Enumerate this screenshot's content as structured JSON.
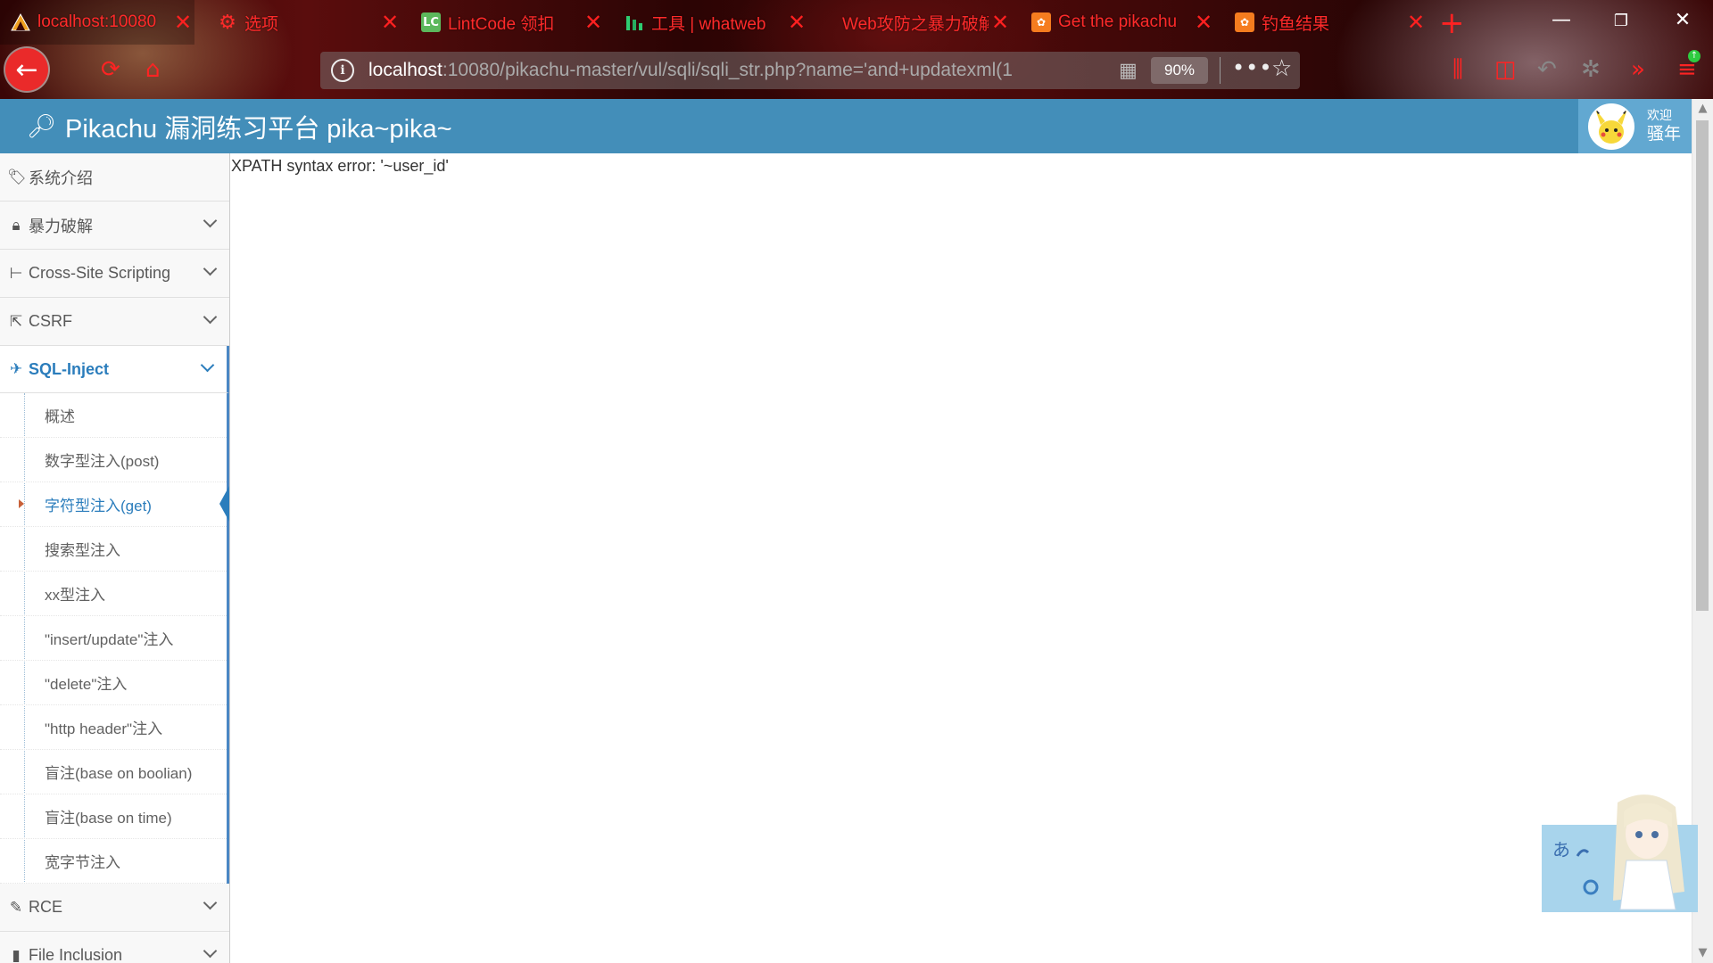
{
  "browser": {
    "tabs": [
      {
        "title": "localhost:10080",
        "icon": "pikachu-logo-icon",
        "active": true
      },
      {
        "title": "选项",
        "icon": "gear-icon",
        "active": false
      },
      {
        "title": "LintCode 领扣",
        "icon": "lintcode-icon",
        "icon_text": "LC",
        "active": false
      },
      {
        "title": "工具 | whatweb",
        "icon": "bar-chart-icon",
        "active": false
      },
      {
        "title": "Web攻防之暴力破解",
        "icon": "",
        "active": false
      },
      {
        "title": "Get the pikachu",
        "icon": "xampp-icon",
        "active": false
      },
      {
        "title": "钓鱼结果",
        "icon": "xampp-icon",
        "active": false
      }
    ],
    "new_tab_glyph": "+",
    "url_host": "localhost",
    "url_rest": ":10080/pikachu-master/vul/sqli/sqli_str.php?name='and+updatexml(1",
    "zoom": "90%",
    "more_glyph": "•••",
    "colors": {
      "tab_text": "#ff2a2a",
      "back_button": "#ea2a2a"
    }
  },
  "header": {
    "title": "Pikachu 漏洞练习平台 pika~pika~",
    "welcome": "欢迎",
    "username": "骚年",
    "background": "#438eb9"
  },
  "sidebar": {
    "items": [
      {
        "label": "系统介绍",
        "icon": "tags-icon",
        "expandable": false
      },
      {
        "label": "暴力破解",
        "icon": "lock-icon",
        "expandable": true
      },
      {
        "label": "Cross-Site Scripting",
        "icon": "tree-icon",
        "expandable": true
      },
      {
        "label": "CSRF",
        "icon": "share-icon",
        "expandable": true
      },
      {
        "label": "SQL-Inject",
        "icon": "plane-icon",
        "expandable": true,
        "open": true
      }
    ],
    "sql_submenu": [
      {
        "label": "概述"
      },
      {
        "label": "数字型注入(post)"
      },
      {
        "label": "字符型注入(get)",
        "active": true
      },
      {
        "label": "搜索型注入"
      },
      {
        "label": "xx型注入"
      },
      {
        "label": "\"insert/update\"注入"
      },
      {
        "label": "\"delete\"注入"
      },
      {
        "label": "\"http header\"注入"
      },
      {
        "label": "盲注(base on boolian)"
      },
      {
        "label": "盲注(base on time)"
      },
      {
        "label": "宽字节注入"
      }
    ],
    "items_after": [
      {
        "label": "RCE",
        "icon": "pencil-icon",
        "expandable": true
      },
      {
        "label": "File Inclusion",
        "icon": "file-icon",
        "expandable": true
      }
    ]
  },
  "main": {
    "error": "XPATH syntax error: '~user_id'"
  }
}
